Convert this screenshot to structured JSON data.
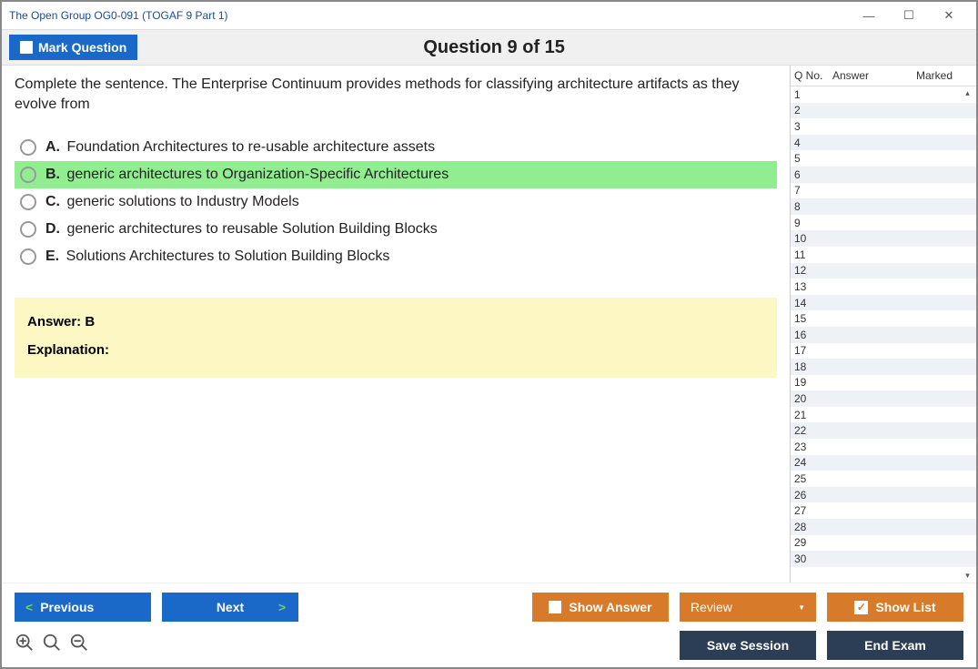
{
  "window": {
    "title": "The Open Group OG0-091 (TOGAF 9 Part 1)"
  },
  "topbar": {
    "mark_label": "Mark Question",
    "question_title": "Question 9 of 15"
  },
  "question": {
    "text": "Complete the sentence. The Enterprise Continuum provides methods for classifying architecture artifacts as they evolve from",
    "options": [
      {
        "letter": "A.",
        "text": "Foundation Architectures to re-usable architecture assets"
      },
      {
        "letter": "B.",
        "text": "generic architectures to Organization-Specific Architectures"
      },
      {
        "letter": "C.",
        "text": "generic solutions to Industry Models"
      },
      {
        "letter": "D.",
        "text": "generic architectures to reusable Solution Building Blocks"
      },
      {
        "letter": "E.",
        "text": "Solutions Architectures to Solution Building Blocks"
      }
    ],
    "correct_index": 1
  },
  "answer_box": {
    "answer_line": "Answer: B",
    "expl_label": "Explanation:"
  },
  "sidebar": {
    "headers": {
      "qno": "Q No.",
      "answer": "Answer",
      "marked": "Marked"
    },
    "rows": 30
  },
  "buttons": {
    "previous": "Previous",
    "next": "Next",
    "show_answer": "Show Answer",
    "review": "Review",
    "show_list": "Show List",
    "save_session": "Save Session",
    "end_exam": "End Exam"
  }
}
